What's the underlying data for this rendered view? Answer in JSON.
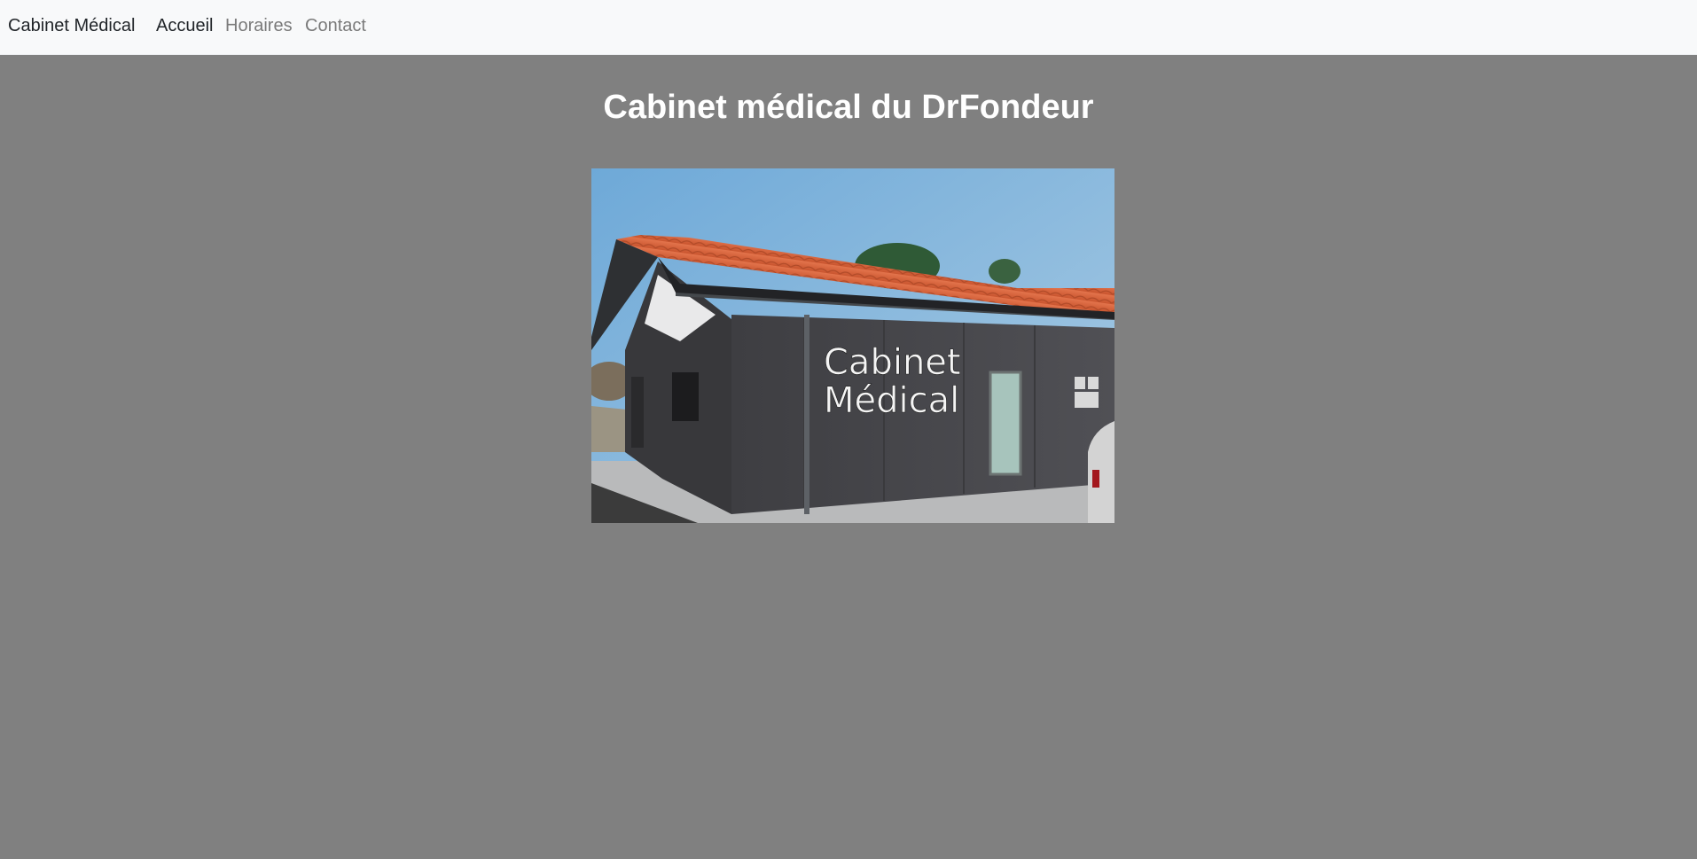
{
  "navbar": {
    "brand": "Cabinet Médical",
    "links": [
      {
        "label": "Accueil",
        "active": true
      },
      {
        "label": "Horaires",
        "active": false
      },
      {
        "label": "Contact",
        "active": false
      }
    ]
  },
  "main": {
    "title": "Cabinet médical du DrFondeur",
    "photo": {
      "sign_line1": "Cabinet",
      "sign_line2": "Médical"
    }
  },
  "colors": {
    "page_background": "#808080",
    "navbar_background": "#f8f9fa",
    "title_color": "#ffffff",
    "roof_tile": "#d9663f",
    "facade": "#4a4a4d",
    "sky": "#86b8dc"
  }
}
